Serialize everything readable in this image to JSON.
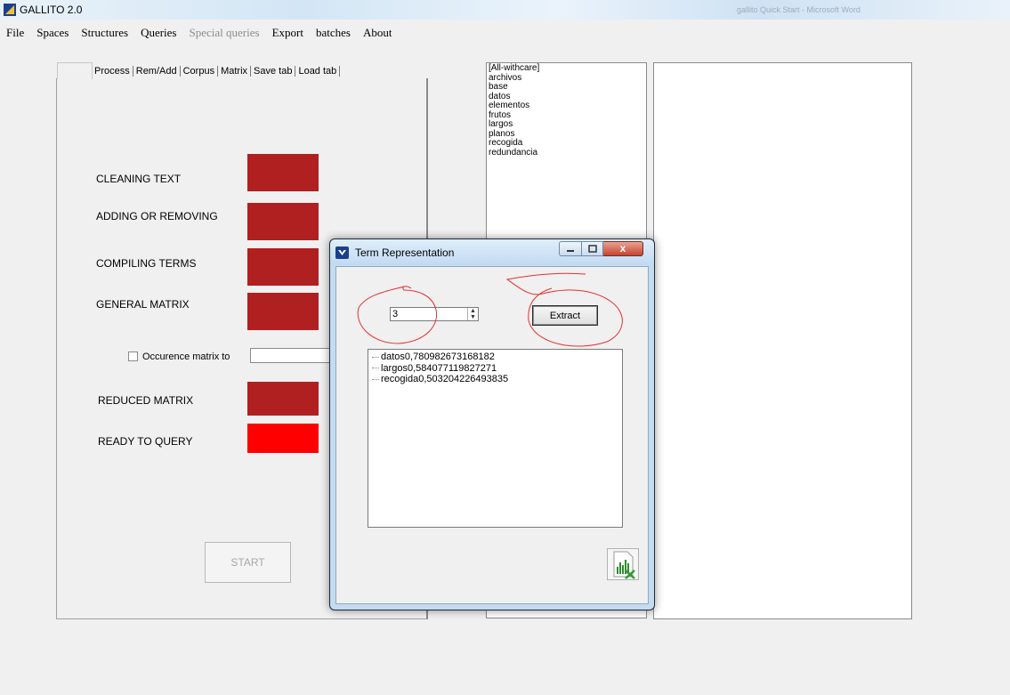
{
  "window": {
    "title": "GALLITO 2.0",
    "taskbar_hint": "gallito Quick Start - Microsoft Word"
  },
  "menu": {
    "items": [
      {
        "label": "File",
        "enabled": true
      },
      {
        "label": "Spaces",
        "enabled": true
      },
      {
        "label": "Structures",
        "enabled": true
      },
      {
        "label": "Queries",
        "enabled": true
      },
      {
        "label": "Special queries",
        "enabled": false
      },
      {
        "label": "Export",
        "enabled": true
      },
      {
        "label": "batches",
        "enabled": true
      },
      {
        "label": "About",
        "enabled": true
      }
    ]
  },
  "tabs": [
    "Process",
    "Rem/Add",
    "Corpus",
    "Matrix",
    "Save tab",
    "Load tab"
  ],
  "process": {
    "steps": [
      {
        "label": "CLEANING TEXT",
        "color": "#b12020"
      },
      {
        "label": "ADDING OR REMOVING",
        "color": "#b12020"
      },
      {
        "label": "COMPILING TERMS",
        "color": "#b12020"
      },
      {
        "label": "GENERAL MATRIX",
        "color": "#b12020"
      },
      {
        "label": "REDUCED MATRIX",
        "color": "#b12020"
      },
      {
        "label": "READY TO QUERY",
        "color": "#ff0000"
      }
    ],
    "occurrence_label": "Occurence matrix to",
    "start_label": "START"
  },
  "term_list": [
    "[All-withcare]",
    "archivos",
    "base",
    "datos",
    "elementos",
    "frutos",
    "largos",
    "planos",
    "recogida",
    "redundancia"
  ],
  "dialog": {
    "title": "Term Representation",
    "close_glyph": "x",
    "number_value": "3",
    "extract_label": "Extract",
    "results": [
      "datos0,780982673168182",
      "largos0,584077119827271",
      "recogida0,503204226493835"
    ]
  }
}
